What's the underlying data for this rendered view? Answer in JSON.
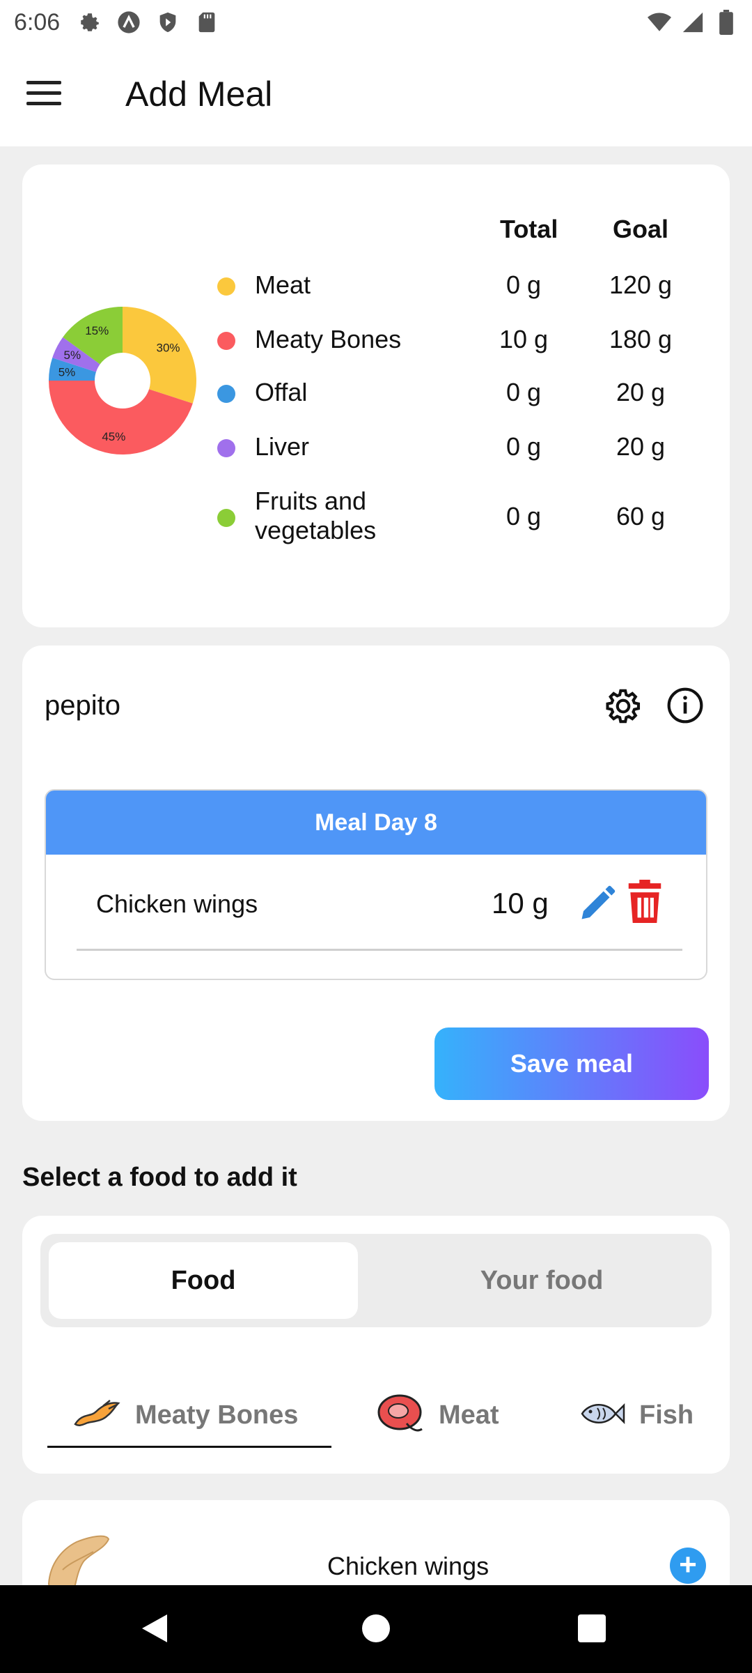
{
  "status_bar": {
    "time": "6:06",
    "icons_left": [
      "settings-icon",
      "a-icon",
      "shield-play-icon",
      "sd-card-icon"
    ],
    "icons_right": [
      "wifi-icon",
      "signal-icon",
      "battery-icon"
    ]
  },
  "app_bar": {
    "title": "Add Meal",
    "menu_icon": "hamburger-menu-icon"
  },
  "summary": {
    "header_total": "Total",
    "header_goal": "Goal",
    "rows": [
      {
        "label": "Meat",
        "total": "0 g",
        "goal": "120 g",
        "color": "#fbc83d"
      },
      {
        "label": "Meaty Bones",
        "total": "10 g",
        "goal": "180 g",
        "color": "#fb5b5f"
      },
      {
        "label": "Offal",
        "total": "0 g",
        "goal": "20 g",
        "color": "#3b97e1"
      },
      {
        "label": "Liver",
        "total": "0 g",
        "goal": "20 g",
        "color": "#a070ec"
      },
      {
        "label": "Fruits and vegetables",
        "total": "0 g",
        "goal": "60 g",
        "color": "#8bcd37"
      }
    ],
    "chart_data": {
      "type": "pie",
      "categories": [
        "Meat",
        "Meaty Bones",
        "Offal",
        "Liver",
        "Fruits and vegetables"
      ],
      "values": [
        30,
        45,
        5,
        5,
        15
      ],
      "labels": [
        "30%",
        "45%",
        "5%",
        "5%",
        "15%"
      ],
      "colors": [
        "#fbc83d",
        "#fb5b5f",
        "#3b97e1",
        "#a070ec",
        "#8bcd37"
      ]
    }
  },
  "meal": {
    "pet_name": "pepito",
    "header": "Meal Day 8",
    "items": [
      {
        "name": "Chicken wings",
        "qty": "10 g"
      }
    ],
    "save_label": "Save meal"
  },
  "select_title": "Select a food to add it",
  "food_toggle": {
    "food": "Food",
    "your_food": "Your food"
  },
  "categories": [
    {
      "label": "Meaty Bones",
      "icon": "chicken-wing-icon"
    },
    {
      "label": "Meat",
      "icon": "steak-icon"
    },
    {
      "label": "Fish",
      "icon": "fish-icon"
    }
  ],
  "food_list": [
    {
      "name": "Chicken wings",
      "icon": "chicken-wing-photo"
    }
  ]
}
